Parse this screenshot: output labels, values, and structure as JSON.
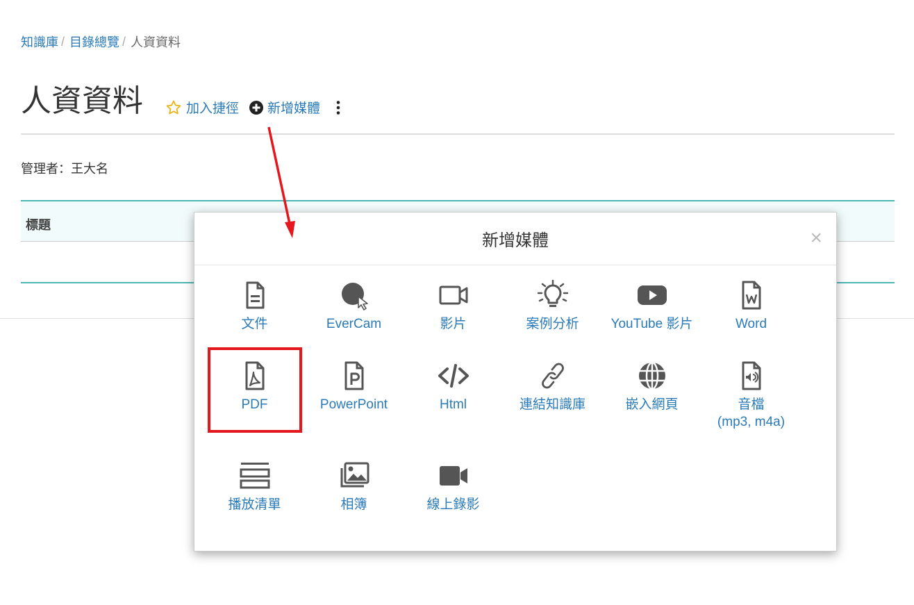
{
  "breadcrumb": {
    "items": [
      "知識庫",
      "目錄總覽"
    ],
    "current": "人資資料",
    "sep": "/"
  },
  "page": {
    "title": "人資資料",
    "add_shortcut": "加入捷徑",
    "add_media": "新增媒體",
    "manager_label": "管理者：王大名"
  },
  "table": {
    "header_title": "標題"
  },
  "modal": {
    "title": "新增媒體",
    "close": "×",
    "items": [
      {
        "label": "文件",
        "icon": "file-icon"
      },
      {
        "label": "EverCam",
        "icon": "evercam-icon"
      },
      {
        "label": "影片",
        "icon": "video-camera-icon"
      },
      {
        "label": "案例分析",
        "icon": "lightbulb-icon"
      },
      {
        "label": "YouTube 影片",
        "icon": "youtube-icon"
      },
      {
        "label": "Word",
        "icon": "word-file-icon"
      },
      {
        "label": "PDF",
        "icon": "pdf-file-icon"
      },
      {
        "label": "PowerPoint",
        "icon": "powerpoint-file-icon"
      },
      {
        "label": "Html",
        "icon": "code-icon"
      },
      {
        "label": "連結知識庫",
        "icon": "link-icon"
      },
      {
        "label": "嵌入網頁",
        "icon": "globe-icon"
      },
      {
        "label": "音檔",
        "label2": "(mp3, m4a)",
        "icon": "audio-file-icon"
      },
      {
        "label": "播放清單",
        "icon": "playlist-icon"
      },
      {
        "label": "相簿",
        "icon": "album-icon"
      },
      {
        "label": "線上錄影",
        "icon": "online-record-icon"
      }
    ]
  },
  "colors": {
    "link": "#2a7ab8",
    "teal": "#4cb6b4",
    "highlight": "#e3171c",
    "arrow": "#e3171c",
    "icon": "#555555"
  }
}
